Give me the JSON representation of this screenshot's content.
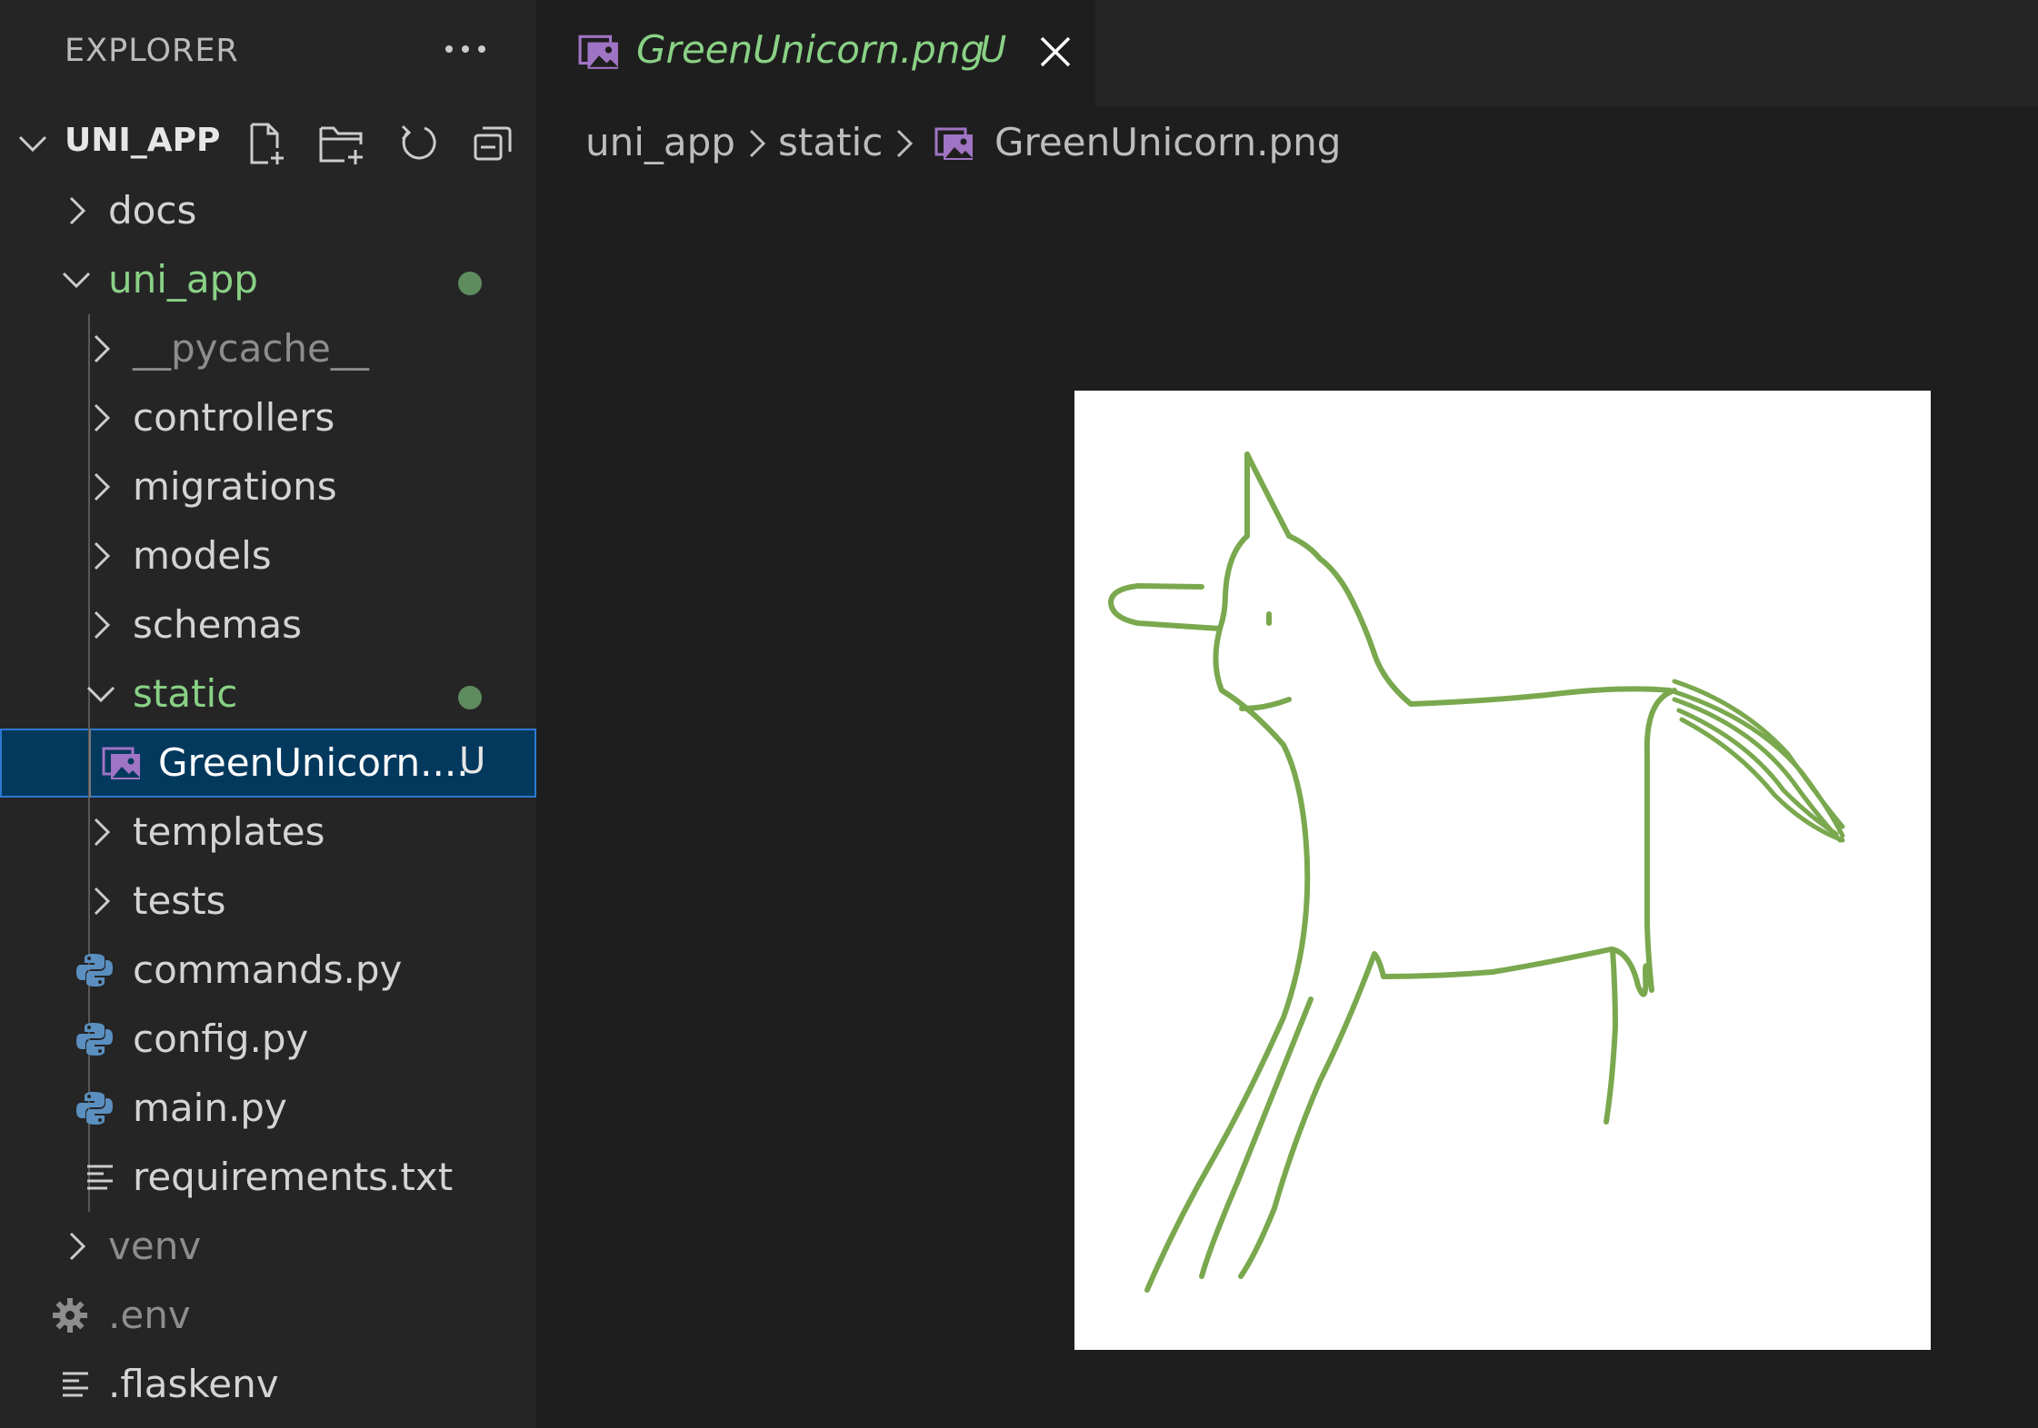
{
  "sidebar": {
    "title": "EXPLORER",
    "workspace": "UNI_APP",
    "actions": [
      "new-file-icon",
      "new-folder-icon",
      "refresh-icon",
      "collapse-all-icon"
    ],
    "items": [
      {
        "label": "docs",
        "type": "folder",
        "state": "collapsed"
      },
      {
        "label": "uni_app",
        "type": "folder",
        "state": "expanded",
        "modified": true
      },
      {
        "label": "__pycache__",
        "type": "folder",
        "state": "collapsed",
        "ignored": true
      },
      {
        "label": "controllers",
        "type": "folder",
        "state": "collapsed"
      },
      {
        "label": "migrations",
        "type": "folder",
        "state": "collapsed"
      },
      {
        "label": "models",
        "type": "folder",
        "state": "collapsed"
      },
      {
        "label": "schemas",
        "type": "folder",
        "state": "collapsed"
      },
      {
        "label": "static",
        "type": "folder",
        "state": "expanded",
        "modified": true
      },
      {
        "label": "GreenUnicorn....",
        "type": "image",
        "status": "U",
        "selected": true
      },
      {
        "label": "templates",
        "type": "folder",
        "state": "collapsed"
      },
      {
        "label": "tests",
        "type": "folder",
        "state": "collapsed"
      },
      {
        "label": "commands.py",
        "type": "python"
      },
      {
        "label": "config.py",
        "type": "python"
      },
      {
        "label": "main.py",
        "type": "python"
      },
      {
        "label": "requirements.txt",
        "type": "text"
      },
      {
        "label": "venv",
        "type": "folder",
        "state": "collapsed",
        "ignored": true
      },
      {
        "label": ".env",
        "type": "settings",
        "ignored": true
      },
      {
        "label": ".flaskenv",
        "type": "text"
      }
    ]
  },
  "editor": {
    "tab": {
      "label": "GreenUnicorn.png",
      "status": "U"
    },
    "breadcrumb": [
      "uni_app",
      "static",
      "GreenUnicorn.png"
    ]
  },
  "colors": {
    "sidebar_bg": "#252526",
    "editor_bg": "#1e1e1e",
    "untracked_green": "#89d185",
    "selection_bg": "#04395e",
    "drawing_green": "#7aa84e"
  }
}
